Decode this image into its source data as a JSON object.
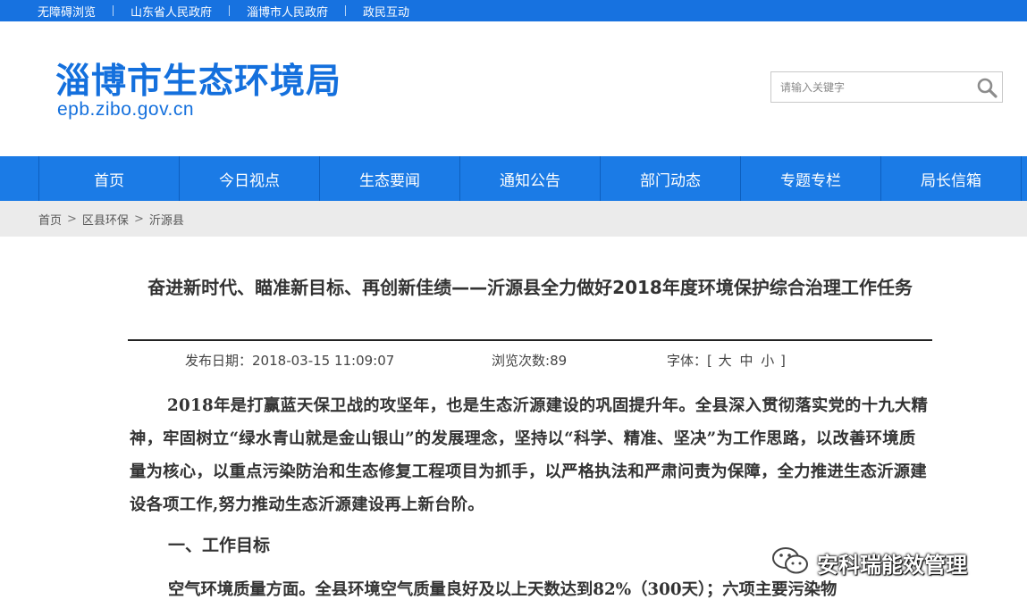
{
  "topbar": {
    "links": [
      "无障碍浏览",
      "山东省人民政府",
      "淄博市人民政府",
      "政民互动"
    ]
  },
  "header": {
    "title": "淄博市生态环境局",
    "domain": "epb.zibo.gov.cn",
    "search_placeholder": "请输入关键字",
    "search_icon": "search-icon"
  },
  "nav": {
    "items": [
      "首页",
      "今日视点",
      "生态要闻",
      "通知公告",
      "部门动态",
      "专题专栏",
      "局长信箱"
    ]
  },
  "breadcrumb": {
    "items": [
      "首页",
      "区县环保",
      "沂源县"
    ],
    "separator": ">"
  },
  "article": {
    "title": "奋进新时代、瞄准新目标、再创新佳绩——沂源县全力做好2018年度环境保护综合治理工作任务",
    "publish_label": "发布日期：",
    "publish_date": "2018-03-15 11:09:07",
    "views_label": "浏览次数:",
    "views": "89",
    "font_label": "字体：[",
    "font_large": "大",
    "font_medium": "中",
    "font_small": "小",
    "font_close": "]",
    "paragraph1": "2018年是打赢蓝天保卫战的攻坚年，也是生态沂源建设的巩固提升年。全县深入贯彻落实党的十九大精神，牢固树立“绿水青山就是金山银山”的发展理念，坚持以“科学、精准、坚决”为工作思路，以改善环境质量为核心，以重点污染防治和生态修复工程项目为抓手，以严格执法和严肃问责为保障，全力推进生态沂源建设各项工作,努力推动生态沂源建设再上新台阶。",
    "heading1": "一、工作目标",
    "paragraph2": "空气环境质量方面。全县环境空气质量良好及以上天数达到82%（300天）；六项主要污染物"
  },
  "watermark": {
    "text": "安科瑞能效管理",
    "icon": "wechat-icon"
  },
  "colors": {
    "primary": "#1772e0",
    "nav": "#1b7be6",
    "crumb_bg": "#ebebeb"
  }
}
